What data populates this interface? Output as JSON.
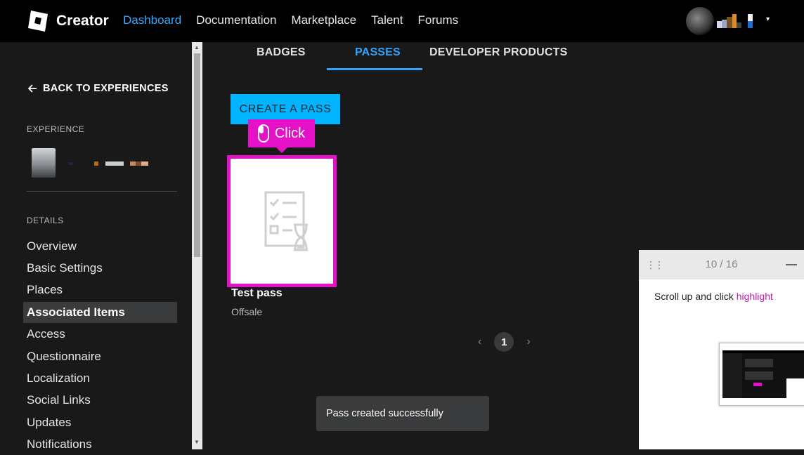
{
  "topnav": {
    "brand": "Creator",
    "links": [
      "Dashboard",
      "Documentation",
      "Marketplace",
      "Talent",
      "Forums"
    ],
    "active_link": "Dashboard",
    "caret": "▾"
  },
  "sidebar": {
    "back_label": "BACK TO EXPERIENCES",
    "experience_label": "EXPERIENCE",
    "details_label": "DETAILS",
    "items": [
      "Overview",
      "Basic Settings",
      "Places",
      "Associated Items",
      "Access",
      "Questionnaire",
      "Localization",
      "Social Links",
      "Updates",
      "Notifications"
    ],
    "selected": "Associated Items"
  },
  "tabs": [
    "BADGES",
    "PASSES",
    "DEVELOPER PRODUCTS"
  ],
  "active_tab": "PASSES",
  "create_button": "CREATE A PASS",
  "click_tooltip": "Click",
  "pass": {
    "name": "Test pass",
    "status": "Offsale"
  },
  "pager": {
    "prev": "‹",
    "page": "1",
    "next": "›"
  },
  "toast": "Pass created successfully",
  "guide": {
    "counter": "10 / 16",
    "text_before": "Scroll up and click ",
    "text_highlight": "highlight"
  },
  "colors": {
    "accent": "#2fa4ff",
    "button": "#02b3ff",
    "highlight": "#e411c9",
    "background": "#191919"
  }
}
